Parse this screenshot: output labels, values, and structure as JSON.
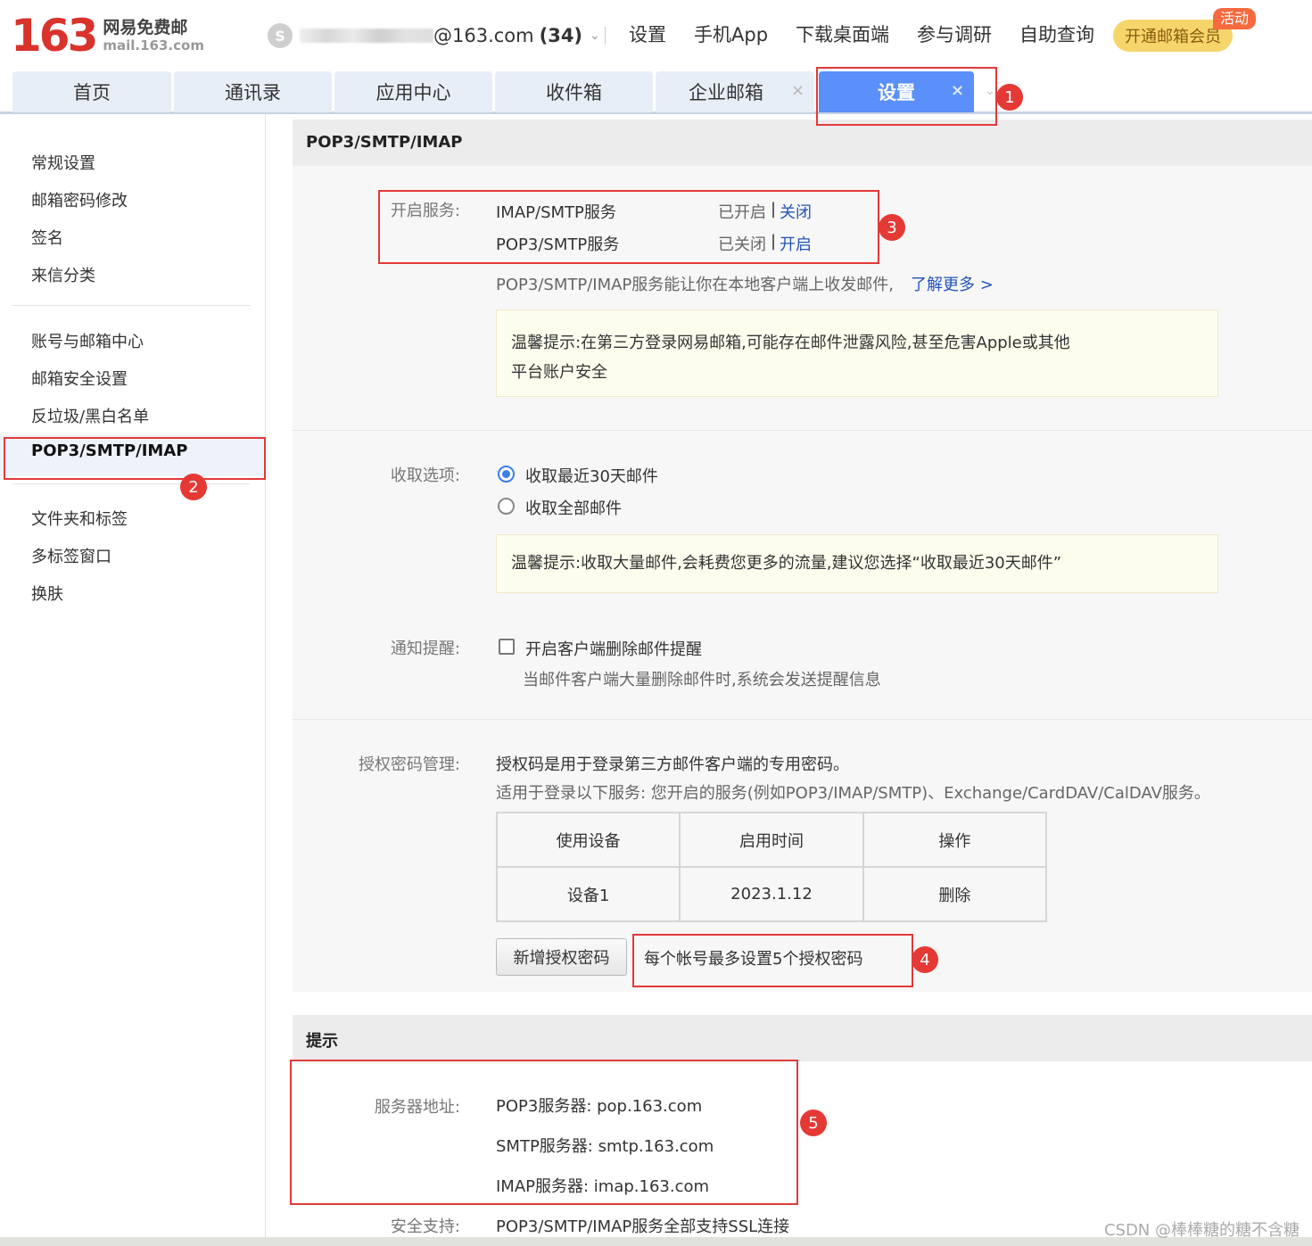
{
  "header": {
    "logo_number": "163",
    "logo_cn": "网易免费邮",
    "logo_en": "mail.163.com",
    "avatar_glyph": "S",
    "email_suffix": "@163.com",
    "unread_count": "(34)",
    "links": [
      "设置",
      "手机App",
      "下载桌面端",
      "参与调研",
      "自助查询"
    ],
    "vip_button": "开通邮箱会员",
    "vip_tag": "活动"
  },
  "tabs": [
    {
      "label": "首页"
    },
    {
      "label": "通讯录"
    },
    {
      "label": "应用中心"
    },
    {
      "label": "收件箱"
    },
    {
      "label": "企业邮箱",
      "close": "×"
    },
    {
      "label": "设置",
      "close": "×",
      "active": true
    }
  ],
  "sidebar": {
    "group1": [
      "常规设置",
      "邮箱密码修改",
      "签名",
      "来信分类"
    ],
    "group2": [
      "账号与邮箱中心",
      "邮箱安全设置",
      "反垃圾/黑白名单",
      "POP3/SMTP/IMAP"
    ],
    "group3": [
      "文件夹和标签",
      "多标签窗口",
      "换肤"
    ]
  },
  "main": {
    "section_title": "POP3/SMTP/IMAP",
    "services": {
      "label": "开启服务:",
      "rows": [
        {
          "name": "IMAP/SMTP服务",
          "status": "已开启",
          "sep": "|",
          "action": "关闭"
        },
        {
          "name": "POP3/SMTP服务",
          "status": "已关闭",
          "sep": "|",
          "action": "开启"
        }
      ],
      "desc": "POP3/SMTP/IMAP服务能让你在本地客户端上收发邮件,",
      "learn_more": "了解更多 >",
      "notice_line1": "温馨提示:在第三方登录网易邮箱,可能存在邮件泄露风险,甚至危害Apple或其他",
      "notice_line2": "平台账户安全"
    },
    "receive": {
      "label": "收取选项:",
      "option1": "收取最近30天邮件",
      "option2": "收取全部邮件",
      "notice": "温馨提示:收取大量邮件,会耗费您更多的流量,建议您选择“收取最近30天邮件”"
    },
    "notify": {
      "label": "通知提醒:",
      "checkbox": "开启客户端删除邮件提醒",
      "desc": "当邮件客户端大量删除邮件时,系统会发送提醒信息"
    },
    "auth": {
      "label": "授权密码管理:",
      "desc1": "授权码是用于登录第三方邮件客户端的专用密码。",
      "desc2": "适用于登录以下服务: 您开启的服务(例如POP3/IMAP/SMTP)、Exchange/CardDAV/CalDAV服务。",
      "columns": [
        "使用设备",
        "启用时间",
        "操作"
      ],
      "row": {
        "device": "设备1",
        "date": "2023.1.12",
        "action": "删除"
      },
      "add_button": "新增授权密码",
      "limit_note": "每个帐号最多设置5个授权密码"
    },
    "tips": {
      "title": "提示",
      "server_label": "服务器地址:",
      "pop3": "POP3服务器: pop.163.com",
      "smtp": "SMTP服务器: smtp.163.com",
      "imap": "IMAP服务器: imap.163.com",
      "security_label": "安全支持:",
      "security": "POP3/SMTP/IMAP服务全部支持SSL连接"
    }
  },
  "annotations": [
    "1",
    "2",
    "3",
    "4",
    "5"
  ],
  "watermark": "CSDN @棒棒糖的糖不含糖",
  "colors": {
    "accent": "#5b8ff9",
    "annotation_red": "#e33939",
    "logo_red": "#d9332c",
    "link": "#2454b5"
  }
}
